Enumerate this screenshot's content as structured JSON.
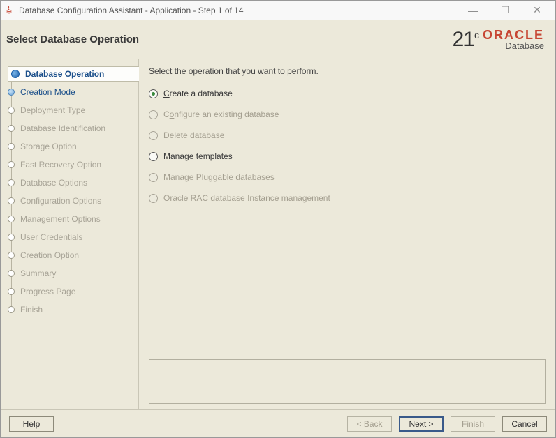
{
  "window": {
    "title": "Database Configuration Assistant - Application - Step 1 of 14"
  },
  "header": {
    "title": "Select Database Operation",
    "logo_version": "21",
    "logo_version_sup": "c",
    "logo_brand": "ORACLE",
    "logo_sub": "Database"
  },
  "sidebar": {
    "steps": [
      {
        "label": "Database Operation",
        "state": "current"
      },
      {
        "label": "Creation Mode",
        "state": "next"
      },
      {
        "label": "Deployment Type",
        "state": "disabled"
      },
      {
        "label": "Database Identification",
        "state": "disabled"
      },
      {
        "label": "Storage Option",
        "state": "disabled"
      },
      {
        "label": "Fast Recovery Option",
        "state": "disabled"
      },
      {
        "label": "Database Options",
        "state": "disabled"
      },
      {
        "label": "Configuration Options",
        "state": "disabled"
      },
      {
        "label": "Management Options",
        "state": "disabled"
      },
      {
        "label": "User Credentials",
        "state": "disabled"
      },
      {
        "label": "Creation Option",
        "state": "disabled"
      },
      {
        "label": "Summary",
        "state": "disabled"
      },
      {
        "label": "Progress Page",
        "state": "disabled"
      },
      {
        "label": "Finish",
        "state": "disabled"
      }
    ]
  },
  "main": {
    "instruction": "Select the operation that you want to perform.",
    "options": [
      {
        "pre": "",
        "mn": "C",
        "post": "reate a database",
        "enabled": true,
        "selected": true
      },
      {
        "pre": "C",
        "mn": "o",
        "post": "nfigure an existing database",
        "enabled": false,
        "selected": false
      },
      {
        "pre": "",
        "mn": "D",
        "post": "elete database",
        "enabled": false,
        "selected": false
      },
      {
        "pre": "Manage ",
        "mn": "t",
        "post": "emplates",
        "enabled": true,
        "selected": false
      },
      {
        "pre": "Manage ",
        "mn": "P",
        "post": "luggable databases",
        "enabled": false,
        "selected": false
      },
      {
        "pre": "Oracle RAC database ",
        "mn": "I",
        "post": "nstance management",
        "enabled": false,
        "selected": false
      }
    ]
  },
  "footer": {
    "help": "elp",
    "help_mn": "H",
    "back": "ack",
    "back_mn": "B",
    "back_pre": "< ",
    "next": "ext >",
    "next_mn": "N",
    "finish": "inish",
    "finish_mn": "F",
    "cancel": "Cancel"
  }
}
